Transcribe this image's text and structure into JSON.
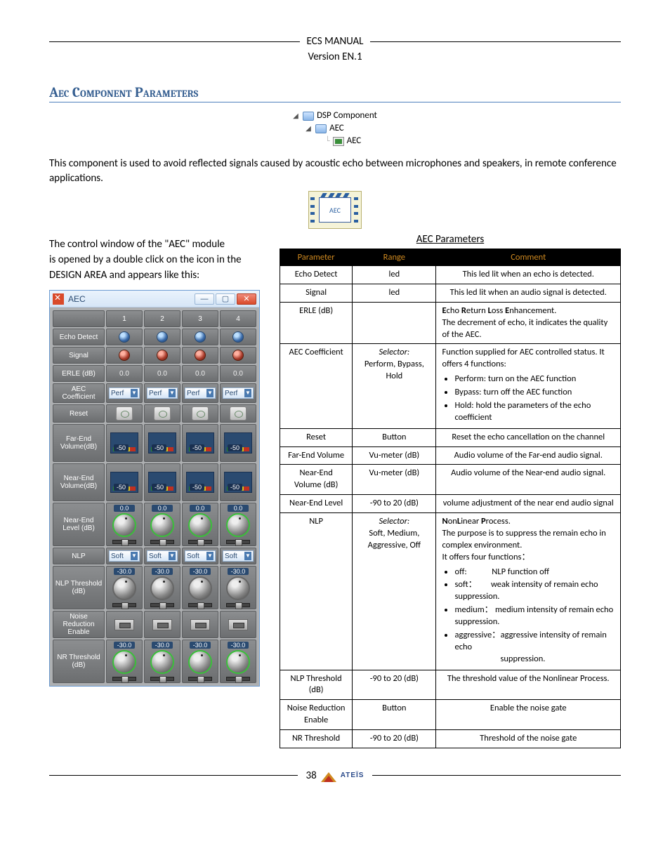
{
  "header": {
    "title": "ECS  MANUAL",
    "version": "Version EN.1"
  },
  "section_heading": "Aec Component Parameters",
  "tree": {
    "root": "DSP Component",
    "child": "AEC",
    "leaf": "AEC"
  },
  "intro_para": "This component is used to avoid reflected signals caused by acoustic echo between microphones and speakers, in remote conference applications.",
  "icon_label": "AEC",
  "para2a": "The control window of the \"AEC\" module",
  "para2b": "is opened by a double click on the icon in the",
  "para2c": "DESIGN AREA and appears like this:",
  "table_caption": "AEC Parameters",
  "win": {
    "title": "AEC",
    "cols": [
      "1",
      "2",
      "3",
      "4"
    ],
    "rows": {
      "echo_detect": "Echo Detect",
      "signal": "Signal",
      "erle": "ERLE (dB)",
      "aec_coef": "AEC Coefficient",
      "reset": "Reset",
      "far_end": "Far-End Volume(dB)",
      "near_end": "Near-End Volume(dB)",
      "near_level": "Near-End Level (dB)",
      "nlp": "NLP",
      "nlp_thresh": "NLP Threshold (dB)",
      "noise_red": "Noise Reduction Enable",
      "nr_thresh": "NR Threshold (dB)"
    },
    "vals": {
      "erle": "0.0",
      "coef_sel": "Perf",
      "vu": "-50",
      "near_level_read": "0.0",
      "nlp_sel": "Soft",
      "nlp_thresh_read": "-30.0",
      "nr_thresh_read": "-30.0"
    }
  },
  "table": {
    "headers": [
      "Parameter",
      "Range",
      "Comment"
    ],
    "rows": [
      {
        "param": "Echo Detect",
        "range": "led",
        "comment_html": "This led lit when an echo is detected.",
        "c_center": true
      },
      {
        "param": "Signal",
        "range": "led",
        "comment_html": "This led lit when an audio signal is detected.",
        "c_center": true
      },
      {
        "param": "ERLE (dB)",
        "range": "",
        "comment_html": "<b>E</b>cho <b>R</b>eturn <b>L</b>oss <b>E</b>nhancement.<br>The decrement of echo, it indicates the quality of the AEC."
      },
      {
        "param": "AEC Coefficient",
        "range": "<i>Selector:</i><br>Perform, Bypass, Hold",
        "comment_html": "Function supplied for AEC controlled status. It offers 4 functions:<ul><li>Perform: turn on the AEC function</li><li>Bypass: turn off the AEC function</li><li>Hold: hold the parameters of the echo coefficient</li></ul>"
      },
      {
        "param": "Reset",
        "range": "Button",
        "comment_html": "Reset the echo cancellation on the channel",
        "c_center": true
      },
      {
        "param": "Far-End Volume",
        "range": "Vu-meter (dB)",
        "comment_html": "Audio volume of the Far-end audio signal.",
        "c_center": true
      },
      {
        "param": "Near-End Volume (dB)",
        "range": "Vu-meter (dB)",
        "comment_html": "Audio volume of the Near-end audio signal.",
        "c_center": true
      },
      {
        "param": "Near-End Level",
        "range": "-90 to 20 (dB)",
        "comment_html": "volume adjustment of the near end audio signal",
        "c_center": true
      },
      {
        "param": "NLP",
        "range": "<i>Selector:</i><br>Soft, Medium, Aggressive, Off",
        "comment_html": "<b>N</b>on<b>L</b>inear <b>P</b>rocess.<br>The purpose is to suppress the remain echo in complex environment.<br>It offers four functions：<ul><li><span class='nlp-off'>off:</span> NLP function off</li><li>soft： &nbsp;&nbsp;&nbsp;&nbsp;&nbsp;&nbsp;weak intensity of remain echo suppression.</li><li>medium： medium intensity of remain echo suppression.</li><li>aggressive：aggressive intensity of remain echo<br>&nbsp;&nbsp;&nbsp;&nbsp;&nbsp;&nbsp;&nbsp;&nbsp;&nbsp;&nbsp;&nbsp;&nbsp;&nbsp;&nbsp;&nbsp;&nbsp;&nbsp;&nbsp;&nbsp;&nbsp;&nbsp;&nbsp;&nbsp;suppression.</li></ul>"
      },
      {
        "param": "NLP Threshold (dB)",
        "range": "-90 to 20 (dB)",
        "comment_html": "The threshold value of the Nonlinear Process.",
        "c_center": true
      },
      {
        "param": "Noise Reduction Enable",
        "range": "Button",
        "comment_html": "Enable the noise gate",
        "c_center": true
      },
      {
        "param": "NR Threshold",
        "range": "-90 to 20 (dB)",
        "comment_html": "Threshold of the noise gate",
        "c_center": true
      }
    ]
  },
  "footer": {
    "page": "38",
    "brand": "ATEÏS"
  }
}
